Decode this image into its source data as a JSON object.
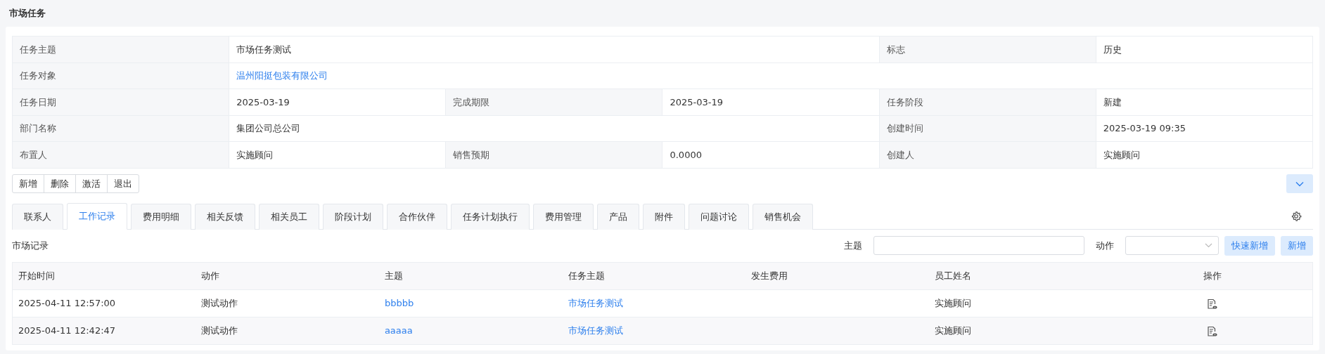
{
  "page_title": "市场任务",
  "details": [
    {
      "cells": [
        {
          "kind": "label",
          "text": "任务主题"
        },
        {
          "kind": "value",
          "text": "市场任务测试"
        },
        {
          "kind": "label",
          "text": "标志"
        },
        {
          "kind": "value",
          "text": "历史"
        }
      ]
    },
    {
      "cells": [
        {
          "kind": "label",
          "text": "任务对象"
        },
        {
          "kind": "link",
          "text": "温州阳挺包装有限公司"
        }
      ]
    },
    {
      "cells": [
        {
          "kind": "label",
          "text": "任务日期"
        },
        {
          "kind": "value",
          "text": "2025-03-19"
        },
        {
          "kind": "label",
          "text": "完成期限"
        },
        {
          "kind": "value",
          "text": "2025-03-19"
        },
        {
          "kind": "label",
          "text": "任务阶段"
        },
        {
          "kind": "value",
          "text": "新建"
        }
      ]
    },
    {
      "cells": [
        {
          "kind": "label",
          "text": "部门名称"
        },
        {
          "kind": "value",
          "text": "集团公司总公司"
        },
        {
          "kind": "label",
          "text": "创建时间"
        },
        {
          "kind": "value",
          "text": "2025-03-19 09:35"
        }
      ]
    },
    {
      "cells": [
        {
          "kind": "label",
          "text": "布置人"
        },
        {
          "kind": "value",
          "text": "实施顾问"
        },
        {
          "kind": "label",
          "text": "销售预期"
        },
        {
          "kind": "value",
          "text": "0.0000"
        },
        {
          "kind": "label",
          "text": "创建人"
        },
        {
          "kind": "value",
          "text": "实施顾问"
        }
      ]
    }
  ],
  "actions": [
    "新增",
    "删除",
    "激活",
    "退出"
  ],
  "tabs": [
    {
      "label": "联系人",
      "selected": false
    },
    {
      "label": "工作记录",
      "selected": true
    },
    {
      "label": "费用明细",
      "selected": false
    },
    {
      "label": "相关反馈",
      "selected": false
    },
    {
      "label": "相关员工",
      "selected": false
    },
    {
      "label": "阶段计划",
      "selected": false
    },
    {
      "label": "合作伙伴",
      "selected": false
    },
    {
      "label": "任务计划执行",
      "selected": false
    },
    {
      "label": "费用管理",
      "selected": false
    },
    {
      "label": "产品",
      "selected": false
    },
    {
      "label": "附件",
      "selected": false
    },
    {
      "label": "问题讨论",
      "selected": false
    },
    {
      "label": "销售机会",
      "selected": false
    }
  ],
  "section_title": "市场记录",
  "filters": [
    {
      "kind": "text",
      "label": "主题"
    },
    {
      "kind": "select",
      "label": "动作"
    }
  ],
  "toolbar_buttons": [
    "快速新增",
    "新增"
  ],
  "table": {
    "columns": [
      "开始时间",
      "动作",
      "主题",
      "任务主题",
      "发生费用",
      "员工姓名",
      "操作"
    ],
    "rows": [
      {
        "start": "2025-04-11 12:57:00",
        "action": "测试动作",
        "subject": "bbbbb",
        "task": "市场任务测试",
        "employee": "实施顾问"
      },
      {
        "start": "2025-04-11 12:42:47",
        "action": "测试动作",
        "subject": "aaaaa",
        "task": "市场任务测试",
        "employee": "实施顾问"
      }
    ]
  }
}
